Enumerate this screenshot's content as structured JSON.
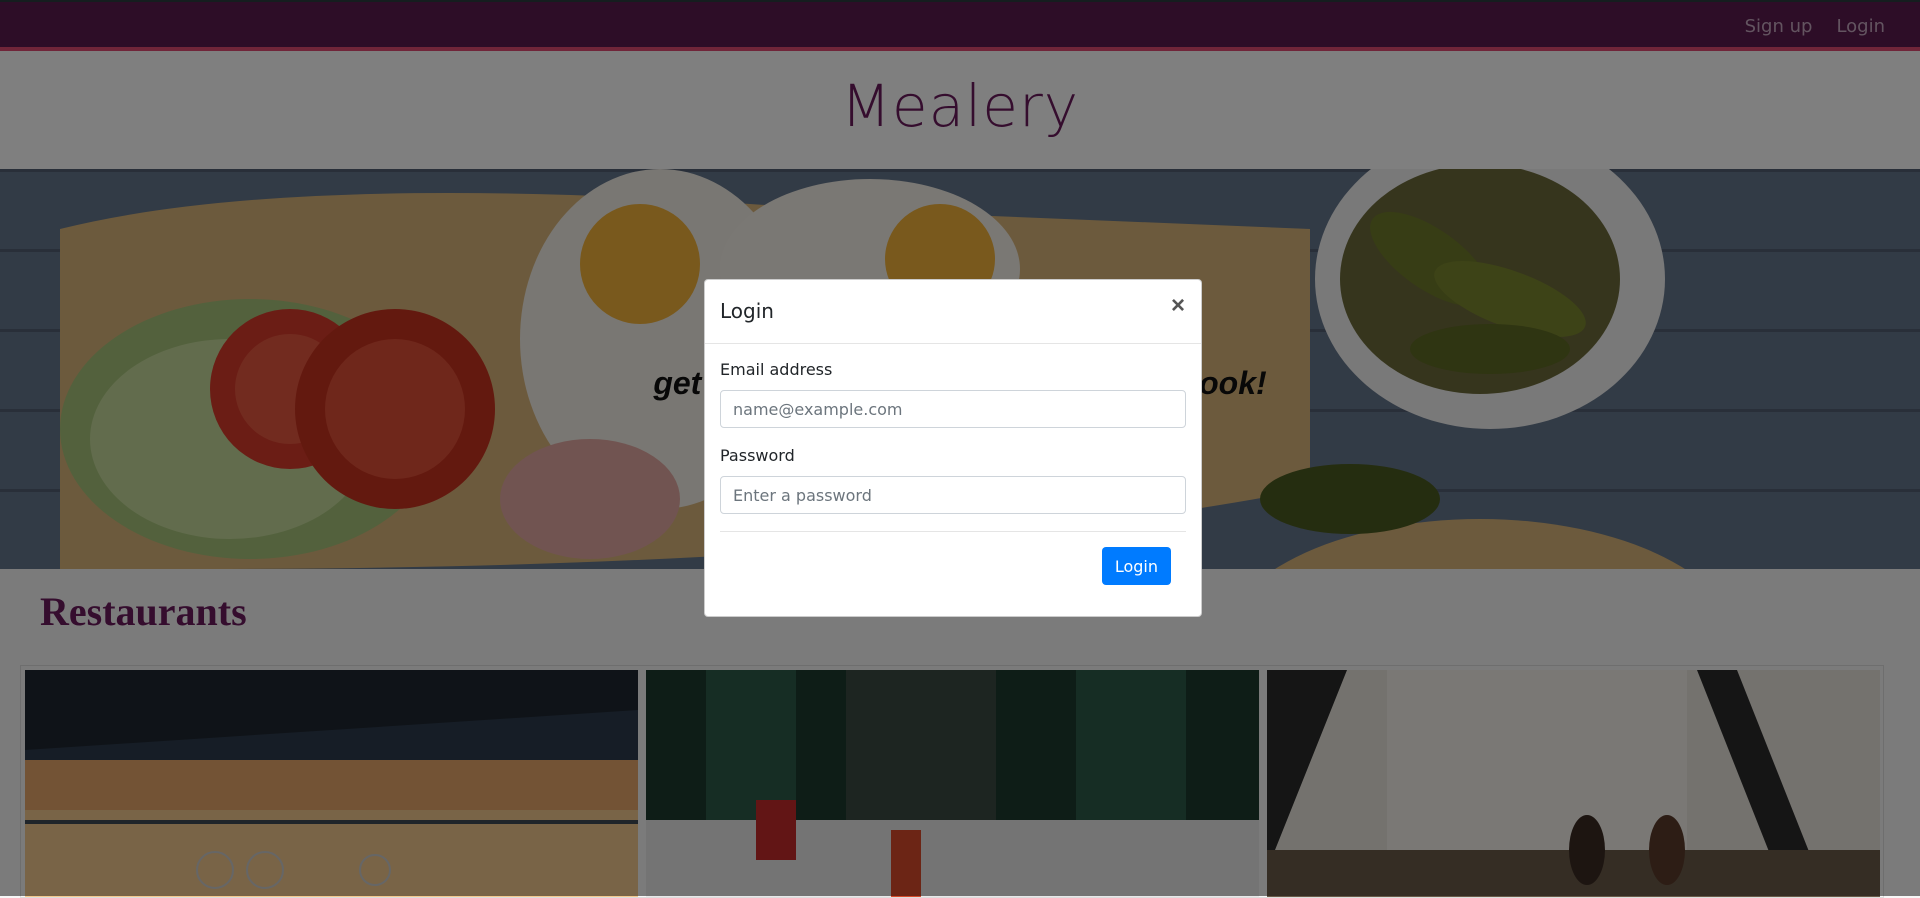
{
  "navbar": {
    "signup_label": "Sign up",
    "login_label": "Login"
  },
  "header": {
    "title": "Mealery"
  },
  "hero": {
    "tagline": "get food that looks as good as you look!"
  },
  "restaurants": {
    "title": "Restaurants"
  },
  "modal": {
    "title": "Login",
    "close_symbol": "×",
    "email_label": "Email address",
    "email_placeholder": "name@example.com",
    "password_label": "Password",
    "password_placeholder": "Enter a password",
    "submit_label": "Login"
  },
  "colors": {
    "brand": "#5a1a4e",
    "accent": "#e04a72",
    "primary_button": "#007bff"
  }
}
